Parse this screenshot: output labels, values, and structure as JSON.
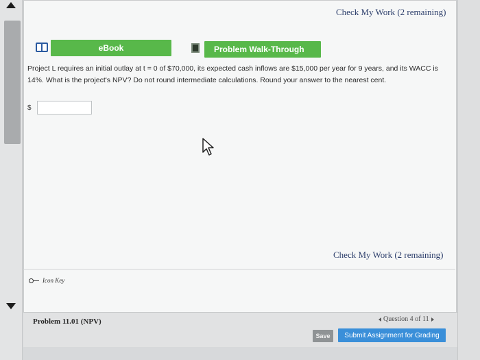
{
  "header": {
    "check_my_work": "Check My Work (2 remaining)"
  },
  "toolbar": {
    "ebook_label": "eBook",
    "walkthrough_label": "Problem Walk-Through"
  },
  "question": {
    "text": "Project L requires an initial outlay at t = 0 of $70,000, its expected cash inflows are $15,000 per year for 9 years, and its WACC is 14%. What is the project's NPV? Do not round intermediate calculations. Round your answer to the nearest cent.",
    "currency_symbol": "$",
    "answer_value": ""
  },
  "check_bottom": "Check My Work (2 remaining)",
  "icon_key": "Icon Key",
  "footer": {
    "problem_label": "Problem 11.01 (NPV)",
    "question_nav": "Question 4 of 11",
    "save_label": "Save",
    "submit_label": "Submit Assignment for Grading"
  },
  "colors": {
    "green_button": "#58b84a",
    "submit_blue": "#3a8fd9",
    "link_navy": "#2c3e6b"
  },
  "icons": [
    "book-icon",
    "film-icon",
    "key-icon",
    "cursor-icon",
    "scroll-up-arrow",
    "scroll-down-arrow"
  ]
}
